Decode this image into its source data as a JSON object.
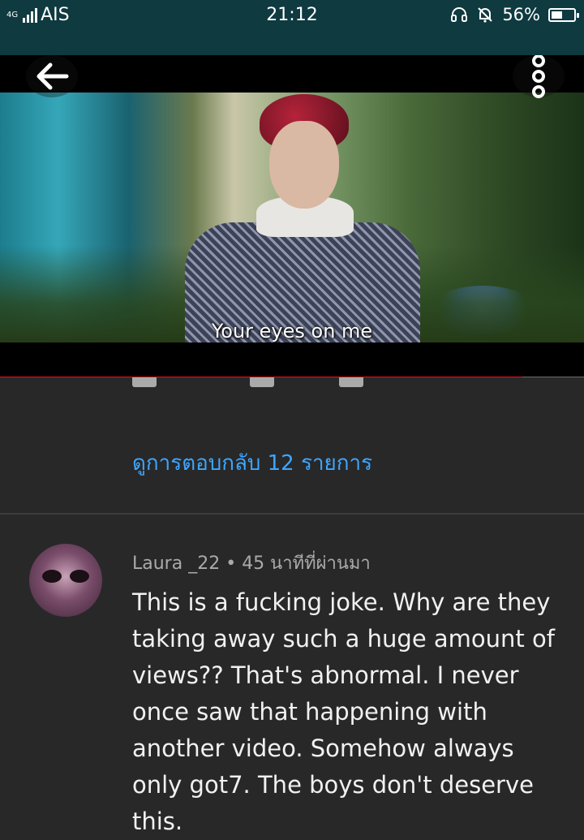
{
  "status_bar": {
    "network_type": "4G",
    "carrier": "AIS",
    "time": "21:12",
    "battery_percent": "56%",
    "battery_level": 0.56,
    "icons": [
      "headset-icon",
      "bell-muted-icon",
      "battery-icon",
      "signal-icon"
    ]
  },
  "video": {
    "subtitle": "Your eyes on me",
    "progress": 0.895,
    "progress_color": "#e4141c"
  },
  "thread": {
    "view_replies_label": "ดูการตอบกลับ 12 รายการ",
    "accent_color": "#3ea6ff"
  },
  "comment": {
    "author": "Laura _22",
    "separator": "•",
    "time_ago": "45 นาทีที่ผ่านมา",
    "text": "This is a fucking joke. Why are they taking away such a huge amount of views?? That's abnormal. I never once saw that happening with another video. Somehow always only got7. The boys don't deserve this."
  }
}
